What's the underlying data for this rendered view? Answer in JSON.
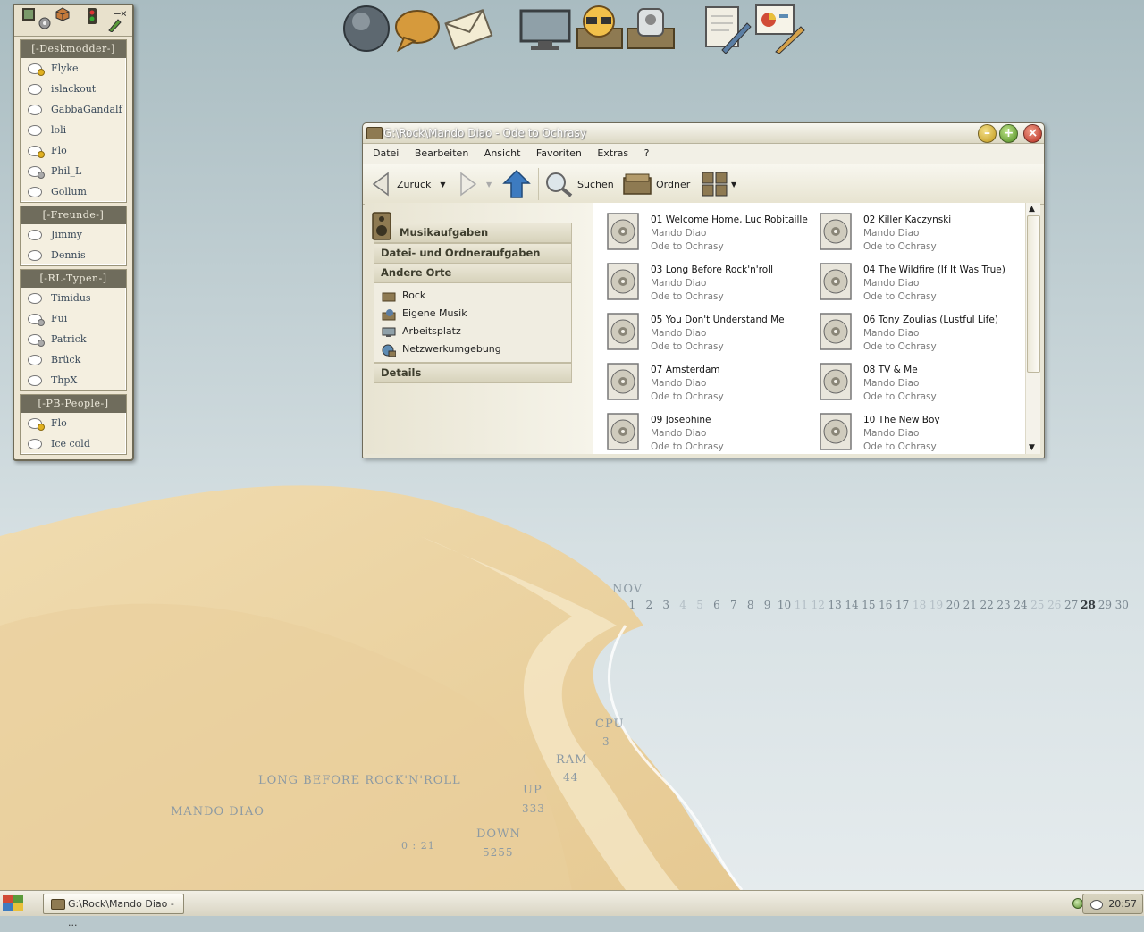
{
  "dock": {
    "icons": [
      "globe-icon",
      "chat-bubble-icon",
      "mail-icon",
      "monitor-icon",
      "user-glasses-icon",
      "hardware-icon",
      "documents-edit-icon",
      "presentation-icon"
    ]
  },
  "buddy_list": {
    "controls": "–×",
    "groups": [
      {
        "title": "[-Deskmodder-]",
        "members": [
          "Flyke",
          "islackout",
          "GabbaGandalf",
          "loli",
          "Flo",
          "Phil_L",
          "Gollum"
        ]
      },
      {
        "title": "[-Freunde-]",
        "members": [
          "Jimmy",
          "Dennis"
        ]
      },
      {
        "title": "[-RL-Typen-]",
        "members": [
          "Timidus",
          "Fui",
          "Patrick",
          "Brück",
          "ThpX"
        ]
      },
      {
        "title": "[-PB-People-]",
        "members": [
          "Flo",
          "Ice cold"
        ]
      }
    ]
  },
  "window": {
    "title": "G:\\Rock\\Mando Diao - Ode to Ochrasy",
    "menu": [
      "Datei",
      "Bearbeiten",
      "Ansicht",
      "Favoriten",
      "Extras",
      "?"
    ],
    "toolbar": {
      "back": "Zurück",
      "search": "Suchen",
      "folders": "Ordner"
    },
    "tasks": {
      "music": "Musikaufgaben",
      "file_folder": "Datei- und Ordneraufgaben",
      "other_places": "Andere Orte",
      "places": [
        "Rock",
        "Eigene Musik",
        "Arbeitsplatz",
        "Netzwerkumgebung"
      ],
      "details": "Details"
    },
    "files": [
      {
        "name": "01 Welcome Home, Luc Robitaille",
        "artist": "Mando Diao",
        "album": "Ode to Ochrasy"
      },
      {
        "name": "02 Killer Kaczynski",
        "artist": "Mando Diao",
        "album": "Ode to Ochrasy"
      },
      {
        "name": "03 Long Before Rock'n'roll",
        "artist": "Mando Diao",
        "album": "Ode to Ochrasy"
      },
      {
        "name": "04 The Wildfire (If It Was True)",
        "artist": "Mando Diao",
        "album": "Ode to Ochrasy"
      },
      {
        "name": "05 You Don't Understand Me",
        "artist": "Mando Diao",
        "album": "Ode to Ochrasy"
      },
      {
        "name": "06 Tony Zoulias (Lustful Life)",
        "artist": "Mando Diao",
        "album": "Ode to Ochrasy"
      },
      {
        "name": "07 Amsterdam",
        "artist": "Mando Diao",
        "album": "Ode to Ochrasy"
      },
      {
        "name": "08 TV & Me",
        "artist": "Mando Diao",
        "album": "Ode to Ochrasy"
      },
      {
        "name": "09 Josephine",
        "artist": "Mando Diao",
        "album": "Ode to Ochrasy"
      },
      {
        "name": "10 The New Boy",
        "artist": "Mando Diao",
        "album": "Ode to Ochrasy"
      }
    ]
  },
  "desktop": {
    "month": "NOV",
    "days": [
      "1",
      "2",
      "3",
      "4",
      "5",
      "6",
      "7",
      "8",
      "9",
      "10",
      "11",
      "12",
      "13",
      "14",
      "15",
      "16",
      "17",
      "18",
      "19",
      "20",
      "21",
      "22",
      "23",
      "24",
      "25",
      "26",
      "27",
      "28",
      "29",
      "30"
    ],
    "today": "28",
    "now_playing_title": "LONG BEFORE ROCK'N'ROLL",
    "now_playing_artist": "MANDO DIAO",
    "elapsed": "0 : 21",
    "cpu_label": "CPU",
    "cpu_value": "3",
    "ram_label": "RAM",
    "ram_value": "44",
    "up_label": "UP",
    "up_value": "333",
    "down_label": "DOWN",
    "down_value": "5255"
  },
  "taskbar": {
    "task": "G:\\Rock\\Mando Diao - ...",
    "clock": "20:57"
  }
}
